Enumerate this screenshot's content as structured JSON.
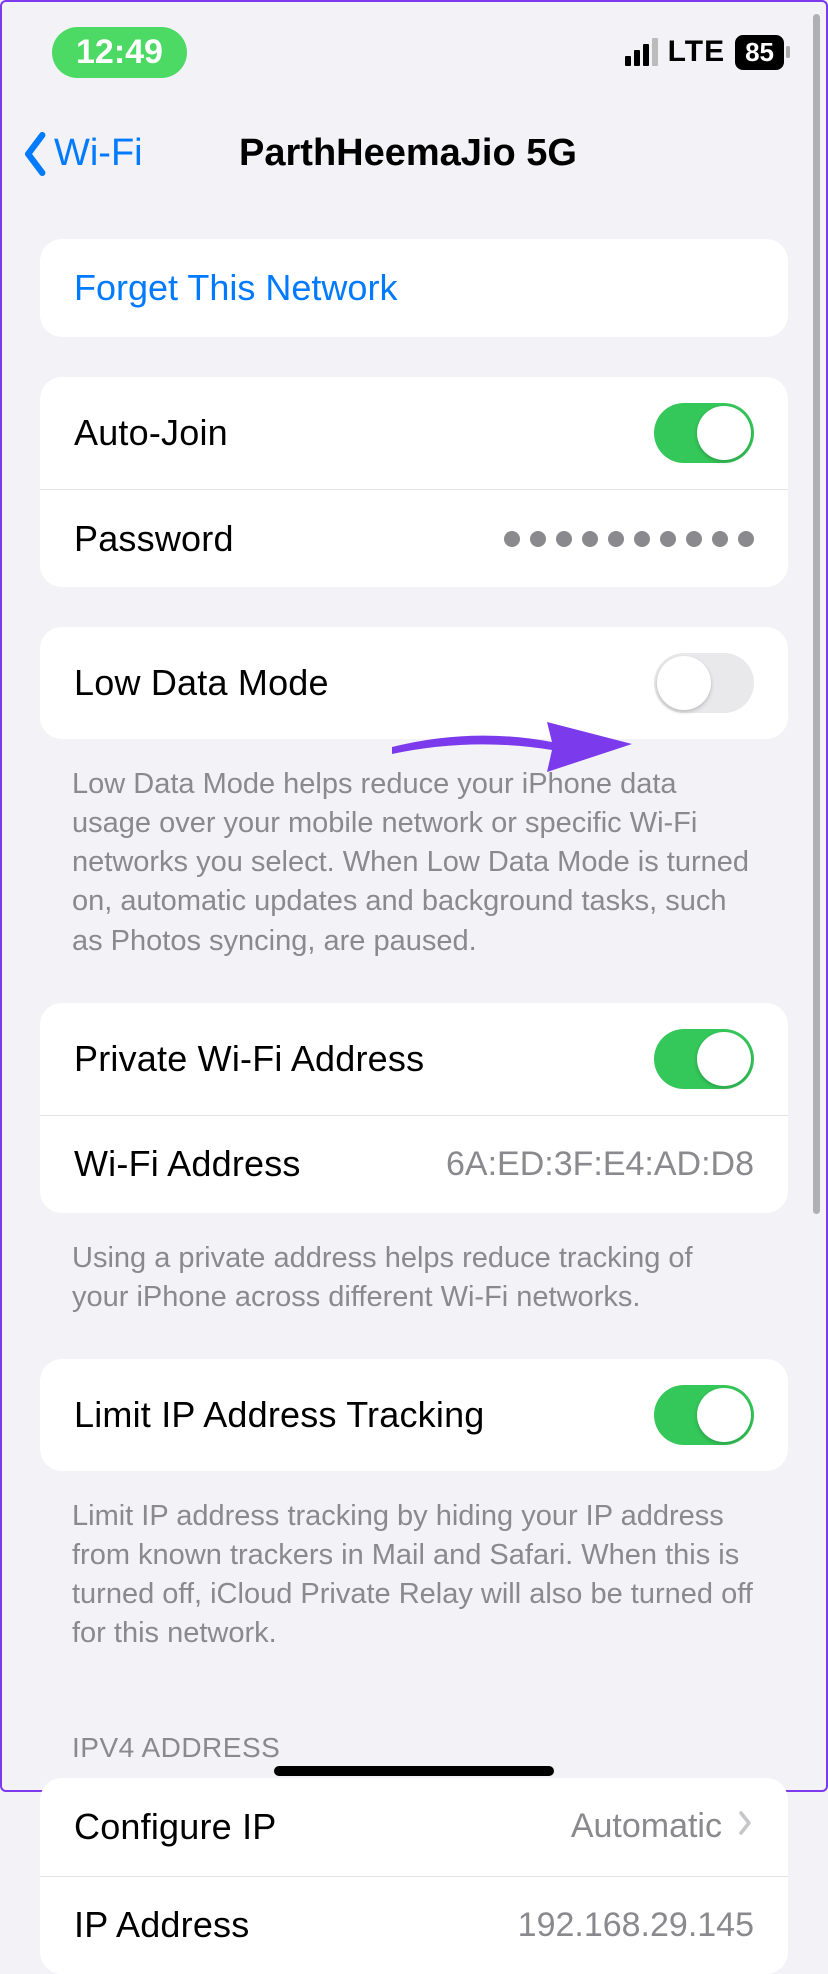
{
  "status": {
    "time": "12:49",
    "network_label": "LTE",
    "battery": "85"
  },
  "nav": {
    "back_label": "Wi-Fi",
    "title": "ParthHeemaJio 5G"
  },
  "forget": {
    "label": "Forget This Network"
  },
  "join": {
    "auto_join_label": "Auto-Join",
    "password_label": "Password"
  },
  "low_data": {
    "label": "Low Data Mode",
    "footer": "Low Data Mode helps reduce your iPhone data usage over your mobile network or specific Wi-Fi networks you select. When Low Data Mode is turned on, automatic updates and background tasks, such as Photos syncing, are paused."
  },
  "private_addr": {
    "toggle_label": "Private Wi-Fi Address",
    "addr_label": "Wi-Fi Address",
    "addr_value": "6A:ED:3F:E4:AD:D8",
    "footer": "Using a private address helps reduce tracking of your iPhone across different Wi-Fi networks."
  },
  "limit_ip": {
    "label": "Limit IP Address Tracking",
    "footer": "Limit IP address tracking by hiding your IP address from known trackers in Mail and Safari. When this is turned off, iCloud Private Relay will also be turned off for this network."
  },
  "ipv4": {
    "header": "IPV4 ADDRESS",
    "configure_label": "Configure IP",
    "configure_value": "Automatic",
    "ip_label": "IP Address",
    "ip_value": "192.168.29.145"
  }
}
